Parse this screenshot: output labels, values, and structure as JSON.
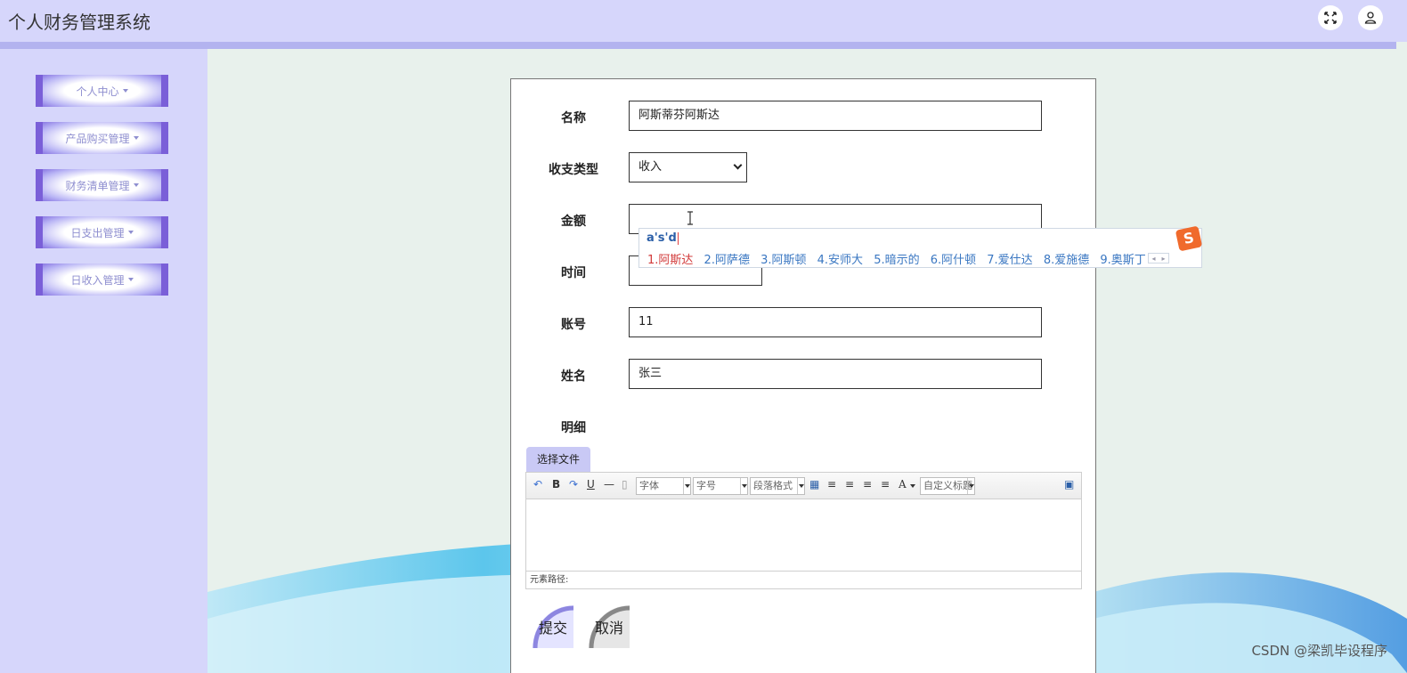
{
  "header": {
    "title": "个人财务管理系统",
    "fullscreen_icon": "fullscreen-icon",
    "user_icon": "user-icon"
  },
  "sidebar": {
    "items": [
      {
        "label": "个人中心"
      },
      {
        "label": "产品购买管理"
      },
      {
        "label": "财务清单管理"
      },
      {
        "label": "日支出管理"
      },
      {
        "label": "日收入管理"
      }
    ]
  },
  "form": {
    "name_label": "名称",
    "name_value": "阿斯蒂芬阿斯达",
    "type_label": "收支类型",
    "type_value": "收入",
    "amount_label": "金额",
    "amount_value": "",
    "time_label": "时间",
    "time_value": "",
    "account_label": "账号",
    "account_value": "11",
    "person_label": "姓名",
    "person_value": "张三",
    "detail_label": "明细"
  },
  "ime": {
    "input": "a's'd",
    "candidates": [
      "1.阿斯达",
      "2.阿萨德",
      "3.阿斯顿",
      "4.安师大",
      "5.暗示的",
      "6.阿什顿",
      "7.爱仕达",
      "8.爱施德",
      "9.奥斯丁"
    ],
    "logo": "S"
  },
  "editor": {
    "file_button": "选择文件",
    "font_combo": "字体",
    "size_combo": "字号",
    "para_combo": "段落格式",
    "custom_combo": "自定义标题",
    "bold": "B",
    "underline": "U",
    "font_color": "A",
    "path_label": "元素路径:"
  },
  "actions": {
    "submit": "提交",
    "cancel": "取消"
  },
  "watermark": "CSDN @梁凯毕设程序",
  "colors": {
    "header_bg": "#d6d6fb",
    "menu_border": "#7a5fd8",
    "content_bg": "#e8f1ec"
  }
}
